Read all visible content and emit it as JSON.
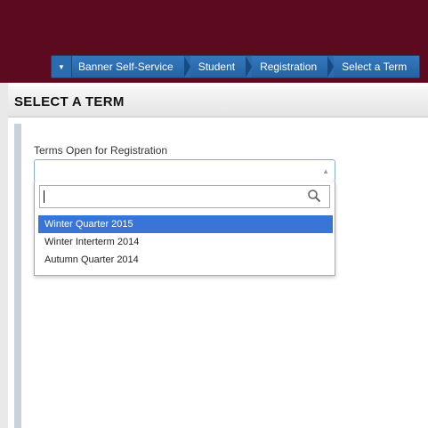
{
  "breadcrumb": {
    "items": [
      "Banner Self-Service",
      "Student",
      "Registration",
      "Select a Term"
    ]
  },
  "page": {
    "title": "SELECT A TERM"
  },
  "term_select": {
    "label": "Terms Open for Registration",
    "selected_value": "",
    "search_value": "",
    "options": [
      "Winter Quarter 2015",
      "Winter Interterm 2014",
      "Autumn Quarter 2014"
    ],
    "highlighted_option": "Winter Quarter 2015"
  },
  "colors": {
    "topbar": "#5c0a1f",
    "breadcrumb": "#2a6cae",
    "highlight": "#3875d7"
  }
}
